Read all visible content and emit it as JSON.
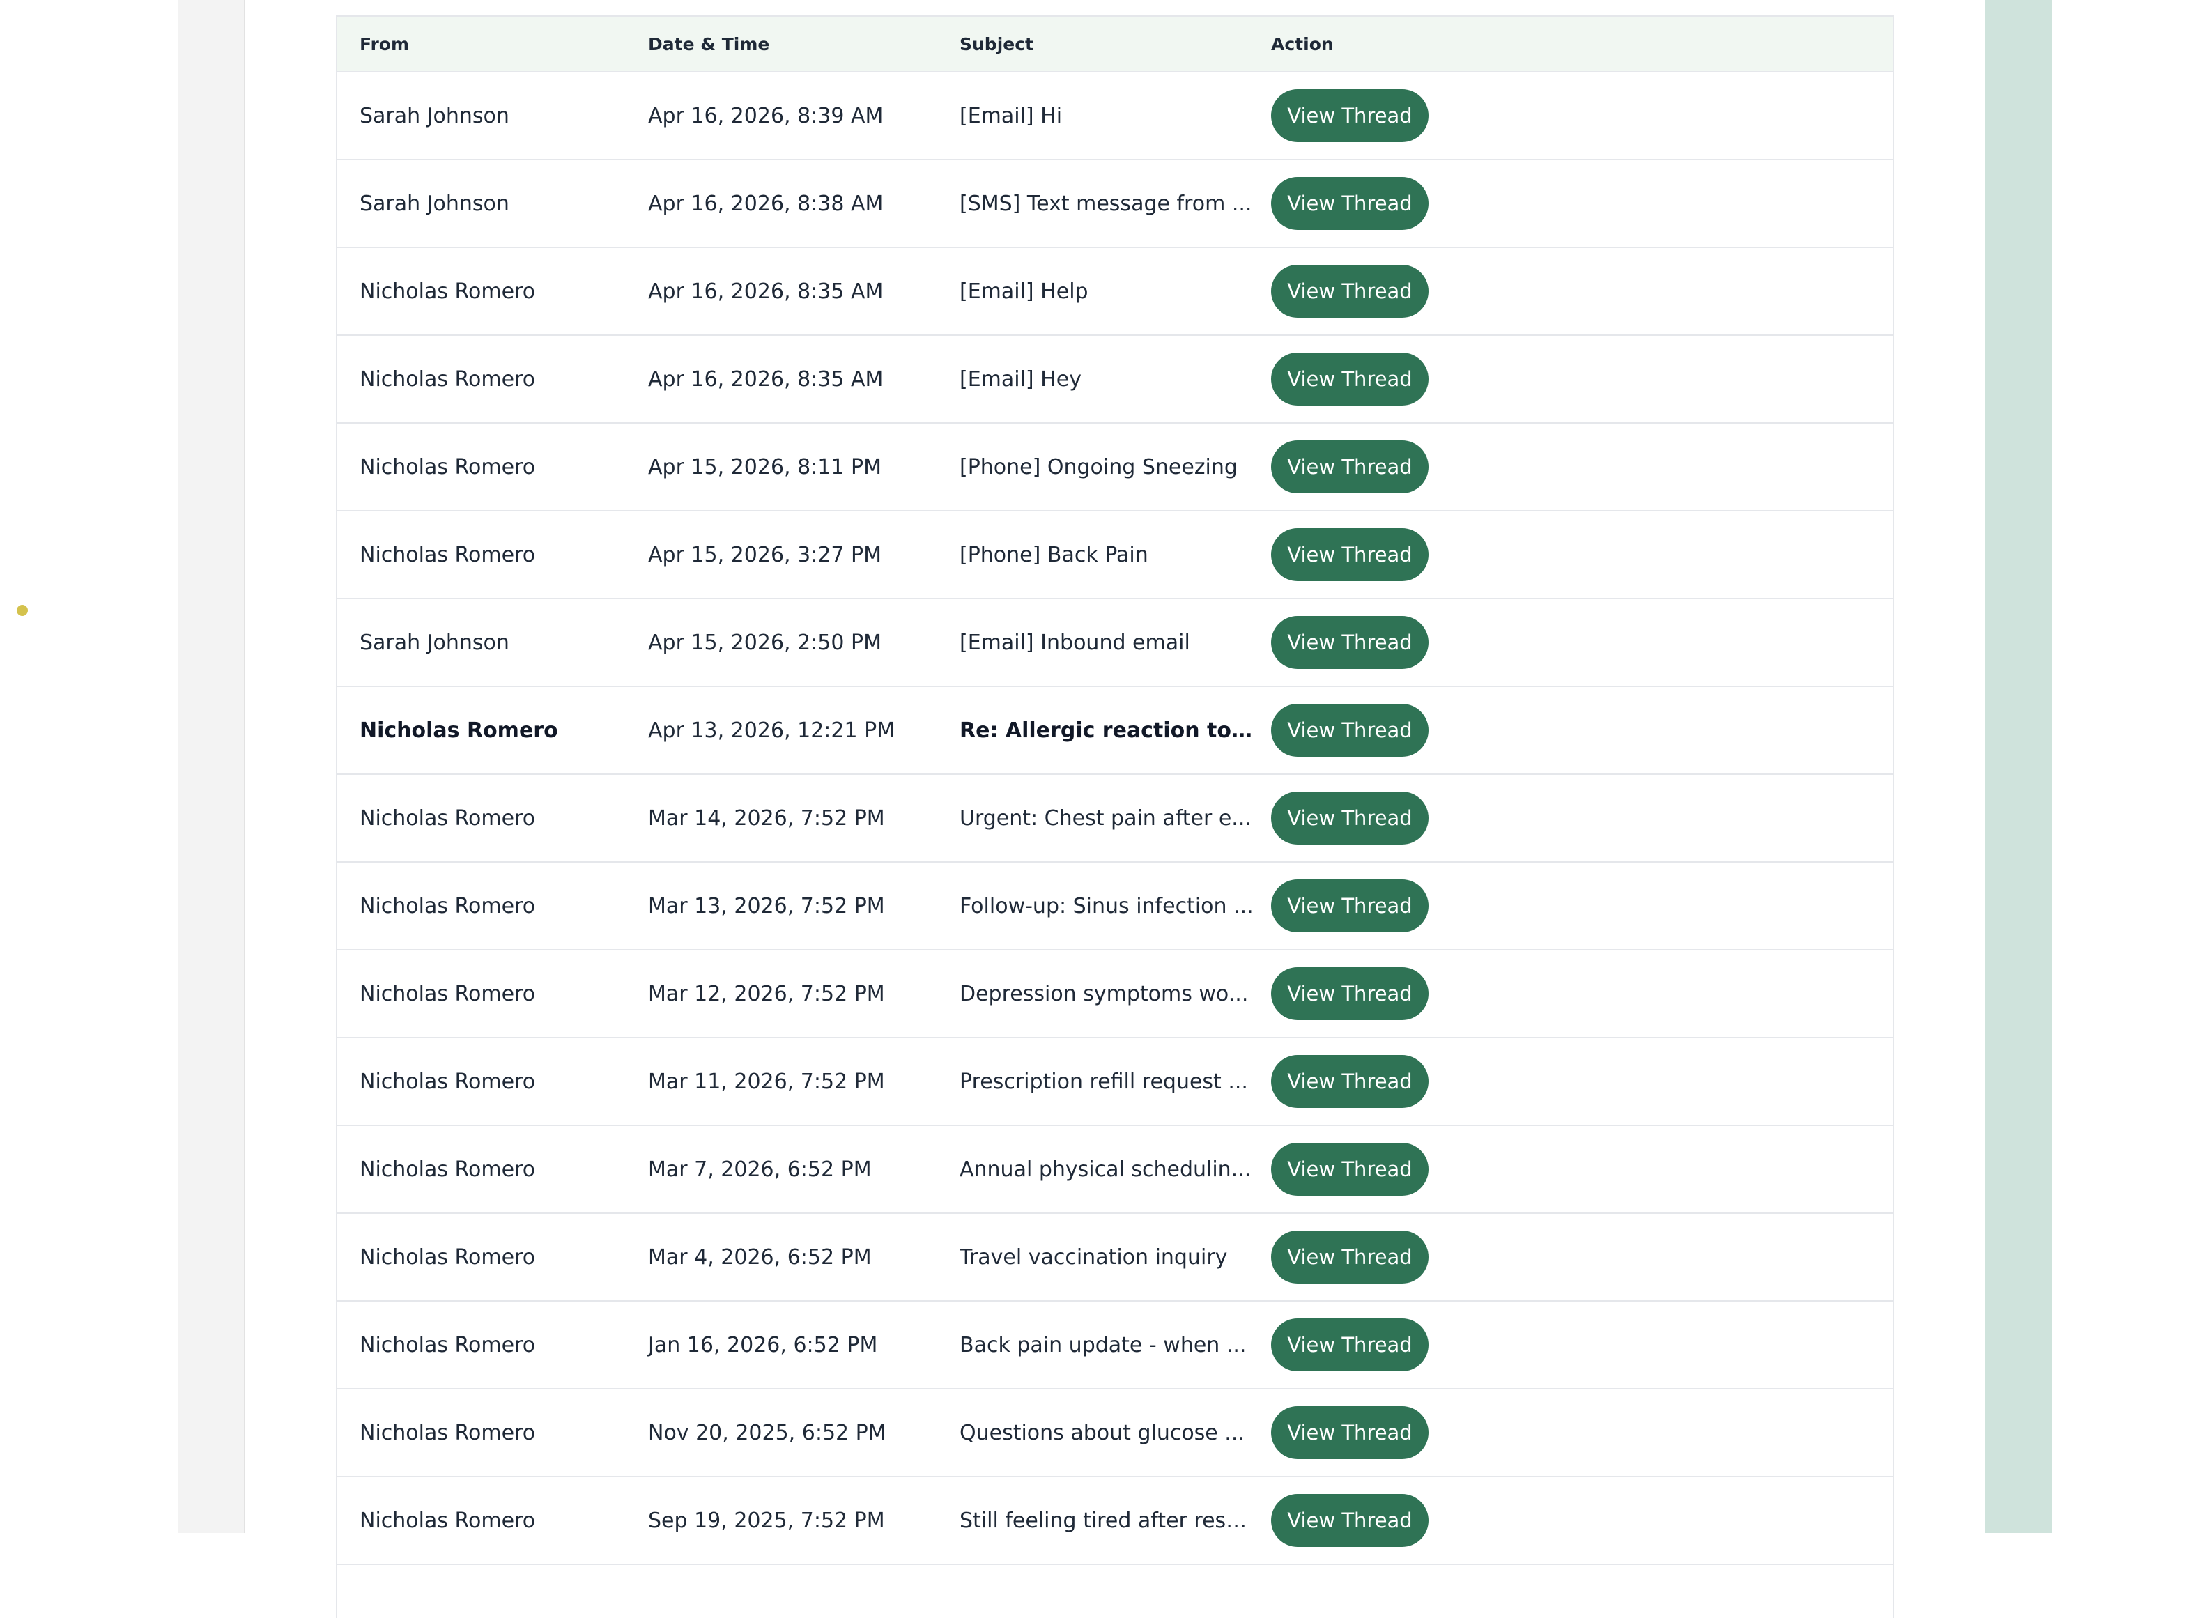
{
  "table": {
    "headers": {
      "from": "From",
      "date": "Date & Time",
      "subject": "Subject",
      "action": "Action"
    },
    "button_label": "View Thread",
    "rows": [
      {
        "from": "Sarah Johnson",
        "date": "Apr 16, 2026, 8:39 AM",
        "subject": "[Email] Hi",
        "unread": false
      },
      {
        "from": "Sarah Johnson",
        "date": "Apr 16, 2026, 8:38 AM",
        "subject": "[SMS] Text message from ...",
        "unread": false
      },
      {
        "from": "Nicholas Romero",
        "date": "Apr 16, 2026, 8:35 AM",
        "subject": "[Email] Help",
        "unread": false
      },
      {
        "from": "Nicholas Romero",
        "date": "Apr 16, 2026, 8:35 AM",
        "subject": "[Email] Hey",
        "unread": false
      },
      {
        "from": "Nicholas Romero",
        "date": "Apr 15, 2026, 8:11 PM",
        "subject": "[Phone] Ongoing Sneezing",
        "unread": false
      },
      {
        "from": "Nicholas Romero",
        "date": "Apr 15, 2026, 3:27 PM",
        "subject": "[Phone] Back Pain",
        "unread": false
      },
      {
        "from": "Sarah Johnson",
        "date": "Apr 15, 2026, 2:50 PM",
        "subject": "[Email] Inbound email",
        "unread": false
      },
      {
        "from": "Nicholas Romero",
        "date": "Apr 13, 2026, 12:21 PM",
        "subject": "Re: Allergic reaction to ne...",
        "unread": true
      },
      {
        "from": "Nicholas Romero",
        "date": "Mar 14, 2026, 7:52 PM",
        "subject": "Urgent: Chest pain after e...",
        "unread": false
      },
      {
        "from": "Nicholas Romero",
        "date": "Mar 13, 2026, 7:52 PM",
        "subject": "Follow-up: Sinus infection ...",
        "unread": false
      },
      {
        "from": "Nicholas Romero",
        "date": "Mar 12, 2026, 7:52 PM",
        "subject": "Depression symptoms wo...",
        "unread": false
      },
      {
        "from": "Nicholas Romero",
        "date": "Mar 11, 2026, 7:52 PM",
        "subject": "Prescription refill request ...",
        "unread": false
      },
      {
        "from": "Nicholas Romero",
        "date": "Mar 7, 2026, 6:52 PM",
        "subject": "Annual physical schedulin...",
        "unread": false
      },
      {
        "from": "Nicholas Romero",
        "date": "Mar 4, 2026, 6:52 PM",
        "subject": "Travel vaccination inquiry",
        "unread": false
      },
      {
        "from": "Nicholas Romero",
        "date": "Jan 16, 2026, 6:52 PM",
        "subject": "Back pain update - when ...",
        "unread": false
      },
      {
        "from": "Nicholas Romero",
        "date": "Nov 20, 2025, 6:52 PM",
        "subject": "Questions about glucose ...",
        "unread": false
      },
      {
        "from": "Nicholas Romero",
        "date": "Sep 19, 2025, 7:52 PM",
        "subject": "Still feeling tired after resp...",
        "unread": false
      }
    ]
  },
  "colors": {
    "button": "#2f7355",
    "header_bg": "#f1f7f2",
    "right_band": "#cfe3dc",
    "indicator_dot": "#d4c24d"
  }
}
